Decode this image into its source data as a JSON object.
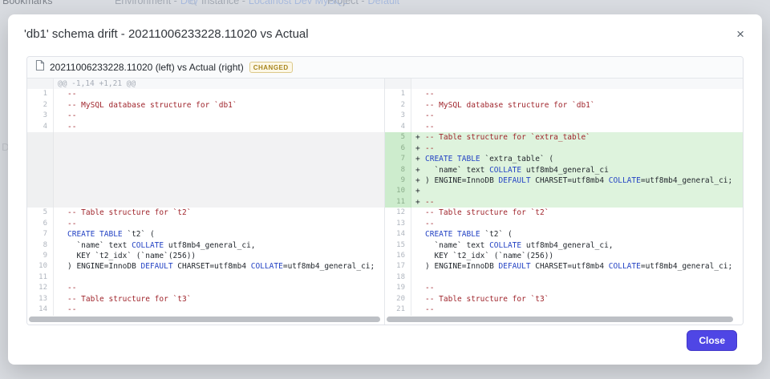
{
  "backdrop": {
    "bookmarks": "Bookmarks",
    "side_letter": "D",
    "env_label": "Environment -",
    "env_link": "Dev",
    "instance_label": "Instance -",
    "instance_link": "Localhost Dev MySQL",
    "project_label": "Project -",
    "project_link": "Default"
  },
  "modal": {
    "title": "'db1' schema drift - 20211006233228.11020 vs Actual",
    "close_icon": "×",
    "close_button": "Close"
  },
  "colors": {
    "accent": "#4f46e5",
    "added_bg": "#def3dd",
    "comment": "#a0262d",
    "keyword": "#2443c4",
    "badge_text": "#a8861e"
  },
  "diff": {
    "file_label": "20211006233228.11020 (left) vs Actual (right)",
    "badge": "CHANGED",
    "hunk": "@@ -1,14 +1,21 @@",
    "left_rows": [
      {
        "t": "hunk",
        "txt": "@@ -1,14 +1,21 @@"
      },
      {
        "t": "ctx",
        "n": "1",
        "seg": [
          [
            "c",
            "--"
          ]
        ]
      },
      {
        "t": "ctx",
        "n": "2",
        "seg": [
          [
            "c",
            "-- MySQL database structure for `db1`"
          ]
        ]
      },
      {
        "t": "ctx",
        "n": "3",
        "seg": [
          [
            "c",
            "--"
          ]
        ]
      },
      {
        "t": "ctx",
        "n": "4",
        "seg": [
          [
            "c",
            "--"
          ]
        ]
      },
      {
        "t": "filler"
      },
      {
        "t": "filler"
      },
      {
        "t": "filler"
      },
      {
        "t": "filler"
      },
      {
        "t": "filler"
      },
      {
        "t": "filler"
      },
      {
        "t": "filler"
      },
      {
        "t": "ctx",
        "n": "5",
        "seg": [
          [
            "c",
            "-- Table structure for `t2`"
          ]
        ]
      },
      {
        "t": "ctx",
        "n": "6",
        "seg": [
          [
            "c",
            "--"
          ]
        ]
      },
      {
        "t": "ctx",
        "n": "7",
        "seg": [
          [
            "k",
            "CREATE TABLE"
          ],
          [
            "p",
            " `t2` ("
          ]
        ]
      },
      {
        "t": "ctx",
        "n": "8",
        "seg": [
          [
            "p",
            "  `name` text "
          ],
          [
            "k",
            "COLLATE"
          ],
          [
            "p",
            " utf8mb4_general_ci,"
          ]
        ]
      },
      {
        "t": "ctx",
        "n": "9",
        "seg": [
          [
            "p",
            "  KEY `t2_idx` (`name`(256))"
          ]
        ]
      },
      {
        "t": "ctx",
        "n": "10",
        "seg": [
          [
            "p",
            ") ENGINE=InnoDB "
          ],
          [
            "k",
            "DEFAULT"
          ],
          [
            "p",
            " CHARSET=utf8mb4 "
          ],
          [
            "k",
            "COLLATE"
          ],
          [
            "p",
            "=utf8mb4_general_ci;"
          ]
        ]
      },
      {
        "t": "ctx",
        "n": "11",
        "seg": []
      },
      {
        "t": "ctx",
        "n": "12",
        "seg": [
          [
            "c",
            "--"
          ]
        ]
      },
      {
        "t": "ctx",
        "n": "13",
        "seg": [
          [
            "c",
            "-- Table structure for `t3`"
          ]
        ]
      },
      {
        "t": "ctx",
        "n": "14",
        "seg": [
          [
            "c",
            "--"
          ]
        ]
      }
    ],
    "right_rows": [
      {
        "t": "hunk",
        "txt": ""
      },
      {
        "t": "ctx",
        "n": "1",
        "seg": [
          [
            "c",
            "--"
          ]
        ]
      },
      {
        "t": "ctx",
        "n": "2",
        "seg": [
          [
            "c",
            "-- MySQL database structure for `db1`"
          ]
        ]
      },
      {
        "t": "ctx",
        "n": "3",
        "seg": [
          [
            "c",
            "--"
          ]
        ]
      },
      {
        "t": "ctx",
        "n": "4",
        "seg": [
          [
            "c",
            "--"
          ]
        ]
      },
      {
        "t": "add",
        "n": "5",
        "seg": [
          [
            "c",
            "-- Table structure for `extra_table`"
          ]
        ]
      },
      {
        "t": "add",
        "n": "6",
        "seg": [
          [
            "c",
            "--"
          ]
        ]
      },
      {
        "t": "add",
        "n": "7",
        "seg": [
          [
            "k",
            "CREATE TABLE"
          ],
          [
            "p",
            " `extra_table` ("
          ]
        ]
      },
      {
        "t": "add",
        "n": "8",
        "seg": [
          [
            "p",
            "  `name` text "
          ],
          [
            "k",
            "COLLATE"
          ],
          [
            "p",
            " utf8mb4_general_ci"
          ]
        ]
      },
      {
        "t": "add",
        "n": "9",
        "seg": [
          [
            "p",
            ") ENGINE=InnoDB "
          ],
          [
            "k",
            "DEFAULT"
          ],
          [
            "p",
            " CHARSET=utf8mb4 "
          ],
          [
            "k",
            "COLLATE"
          ],
          [
            "p",
            "=utf8mb4_general_ci;"
          ]
        ]
      },
      {
        "t": "add",
        "n": "10",
        "seg": []
      },
      {
        "t": "add",
        "n": "11",
        "seg": [
          [
            "c",
            "--"
          ]
        ]
      },
      {
        "t": "ctx",
        "n": "12",
        "seg": [
          [
            "c",
            "-- Table structure for `t2`"
          ]
        ]
      },
      {
        "t": "ctx",
        "n": "13",
        "seg": [
          [
            "c",
            "--"
          ]
        ]
      },
      {
        "t": "ctx",
        "n": "14",
        "seg": [
          [
            "k",
            "CREATE TABLE"
          ],
          [
            "p",
            " `t2` ("
          ]
        ]
      },
      {
        "t": "ctx",
        "n": "15",
        "seg": [
          [
            "p",
            "  `name` text "
          ],
          [
            "k",
            "COLLATE"
          ],
          [
            "p",
            " utf8mb4_general_ci,"
          ]
        ]
      },
      {
        "t": "ctx",
        "n": "16",
        "seg": [
          [
            "p",
            "  KEY `t2_idx` (`name`(256))"
          ]
        ]
      },
      {
        "t": "ctx",
        "n": "17",
        "seg": [
          [
            "p",
            ") ENGINE=InnoDB "
          ],
          [
            "k",
            "DEFAULT"
          ],
          [
            "p",
            " CHARSET=utf8mb4 "
          ],
          [
            "k",
            "COLLATE"
          ],
          [
            "p",
            "=utf8mb4_general_ci;"
          ]
        ]
      },
      {
        "t": "ctx",
        "n": "18",
        "seg": []
      },
      {
        "t": "ctx",
        "n": "19",
        "seg": [
          [
            "c",
            "--"
          ]
        ]
      },
      {
        "t": "ctx",
        "n": "20",
        "seg": [
          [
            "c",
            "-- Table structure for `t3`"
          ]
        ]
      },
      {
        "t": "ctx",
        "n": "21",
        "seg": [
          [
            "c",
            "--"
          ]
        ]
      }
    ]
  }
}
